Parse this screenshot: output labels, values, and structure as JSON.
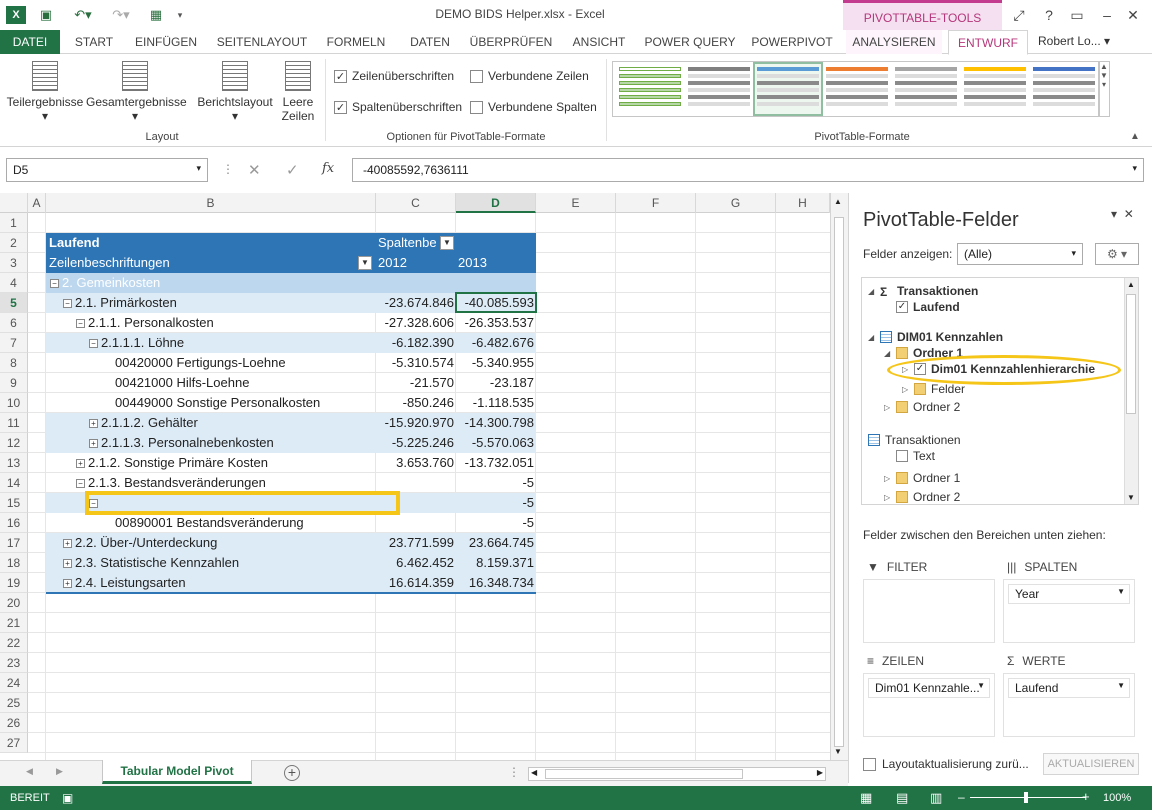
{
  "title": "DEMO BIDS Helper.xlsx - Excel",
  "contextual_tab_group": "PIVOTTABLE-TOOLS",
  "user": "Robert Lo...",
  "tabs": [
    "DATEI",
    "START",
    "EINFÜGEN",
    "SEITENLAYOUT",
    "FORMELN",
    "DATEN",
    "ÜBERPRÜFEN",
    "ANSICHT",
    "POWER QUERY",
    "POWERPIVOT",
    "ANALYSIEREN",
    "ENTWURF"
  ],
  "active_tab": "ENTWURF",
  "ribbon": {
    "layout_buttons": [
      "Teilergebnisse",
      "Gesamtergebnisse",
      "Berichtslayout",
      "Leere Zeilen"
    ],
    "layout_group": "Layout",
    "options": [
      {
        "label": "Zeilenüberschriften",
        "checked": true
      },
      {
        "label": "Verbundene Zeilen",
        "checked": false
      },
      {
        "label": "Spaltenüberschriften",
        "checked": true
      },
      {
        "label": "Verbundene Spalten",
        "checked": false
      }
    ],
    "options_group": "Optionen für PivotTable-Formate",
    "styles_group": "PivotTable-Formate",
    "style_colors": [
      "#70ad47",
      "#7f7f7f",
      "#5b9bd5",
      "#ed7d31",
      "#a5a5a5",
      "#ffc000",
      "#4472c4"
    ]
  },
  "formula_bar": {
    "name_box": "D5",
    "formula": "-40085592,7636111"
  },
  "columns": [
    "A",
    "B",
    "C",
    "D",
    "E",
    "F",
    "G",
    "H"
  ],
  "selected_column": "D",
  "selected_row": 5,
  "rows": [
    "1",
    "2",
    "3",
    "4",
    "5",
    "6",
    "7",
    "8",
    "9",
    "10",
    "11",
    "12",
    "13",
    "14",
    "15",
    "16",
    "17",
    "18",
    "19",
    "20",
    "21",
    "22",
    "23",
    "24",
    "25",
    "26",
    "27"
  ],
  "pivot": {
    "header_measure": "Laufend",
    "header_columns": "Spaltenbe",
    "header_rows": "Zeilenbeschriftungen",
    "year1": "2012",
    "year2": "2013",
    "lines": [
      {
        "row": 4,
        "label": "2. Gemeinkosten",
        "indent": 0,
        "toggle": "-",
        "c": "",
        "d": "",
        "style": "lvl1"
      },
      {
        "row": 5,
        "label": "2.1. Primärkosten",
        "indent": 1,
        "toggle": "-",
        "c": "-23.674.846",
        "d": "-40.085.593",
        "style": "band"
      },
      {
        "row": 6,
        "label": "2.1.1. Personalkosten",
        "indent": 2,
        "toggle": "-",
        "c": "-27.328.606",
        "d": "-26.353.537",
        "style": ""
      },
      {
        "row": 7,
        "label": "2.1.1.1. Löhne",
        "indent": 3,
        "toggle": "-",
        "c": "-6.182.390",
        "d": "-6.482.676",
        "style": "band"
      },
      {
        "row": 8,
        "label": "00420000 Fertigungs-Loehne",
        "indent": 5,
        "toggle": "",
        "c": "-5.310.574",
        "d": "-5.340.955",
        "style": ""
      },
      {
        "row": 9,
        "label": "00421000 Hilfs-Loehne",
        "indent": 5,
        "toggle": "",
        "c": "-21.570",
        "d": "-23.187",
        "style": ""
      },
      {
        "row": 10,
        "label": "00449000 Sonstige Personalkosten",
        "indent": 5,
        "toggle": "",
        "c": "-850.246",
        "d": "-1.118.535",
        "style": ""
      },
      {
        "row": 11,
        "label": "2.1.1.2. Gehälter",
        "indent": 3,
        "toggle": "+",
        "c": "-15.920.970",
        "d": "-14.300.798",
        "style": "band"
      },
      {
        "row": 12,
        "label": "2.1.1.3. Personalnebenkosten",
        "indent": 3,
        "toggle": "+",
        "c": "-5.225.246",
        "d": "-5.570.063",
        "style": "band"
      },
      {
        "row": 13,
        "label": "2.1.2. Sonstige Primäre Kosten",
        "indent": 2,
        "toggle": "+",
        "c": "3.653.760",
        "d": "-13.732.051",
        "style": ""
      },
      {
        "row": 14,
        "label": "2.1.3. Bestandsveränderungen",
        "indent": 2,
        "toggle": "-",
        "c": "",
        "d": "-5",
        "style": ""
      },
      {
        "row": 15,
        "label": "",
        "indent": 3,
        "toggle": "-",
        "c": "",
        "d": "-5",
        "style": "band"
      },
      {
        "row": 16,
        "label": "00890001 Bestandsveränderung",
        "indent": 5,
        "toggle": "",
        "c": "",
        "d": "-5",
        "style": ""
      },
      {
        "row": 17,
        "label": "2.2. Über-/Unterdeckung",
        "indent": 1,
        "toggle": "+",
        "c": "23.771.599",
        "d": "23.664.745",
        "style": "band"
      },
      {
        "row": 18,
        "label": "2.3. Statistische Kennzahlen",
        "indent": 1,
        "toggle": "+",
        "c": "6.462.452",
        "d": "8.159.371",
        "style": "band"
      },
      {
        "row": 19,
        "label": "2.4. Leistungsarten",
        "indent": 1,
        "toggle": "+",
        "c": "16.614.359",
        "d": "16.348.734",
        "style": "band"
      }
    ]
  },
  "panel": {
    "title": "PivotTable-Felder",
    "show_fields_label": "Felder anzeigen:",
    "show_fields_value": "(Alle)",
    "fields": [
      {
        "label": "Transaktionen",
        "type": "sigma",
        "bold": true
      },
      {
        "label": "Laufend",
        "type": "check",
        "checked": true,
        "bold": true
      },
      {
        "label": "DIM01 Kennzahlen",
        "type": "table",
        "bold": true
      },
      {
        "label": "Ordner 1",
        "type": "folder",
        "bold": true
      },
      {
        "label": "Dim01 Kennzahlenhierarchie",
        "type": "check",
        "checked": true,
        "bold": true
      },
      {
        "label": "Felder",
        "type": "folder",
        "bold": false
      },
      {
        "label": "Ordner 2",
        "type": "folder",
        "bold": false
      },
      {
        "label": "Transaktionen",
        "type": "table",
        "bold": false
      },
      {
        "label": "Text",
        "type": "check",
        "checked": false,
        "bold": false
      },
      {
        "label": "Ordner 1",
        "type": "folder",
        "bold": false
      },
      {
        "label": "Ordner 2",
        "type": "folder",
        "bold": false
      }
    ],
    "drag_label": "Felder zwischen den Bereichen unten ziehen:",
    "areas": {
      "filter": {
        "label": "FILTER",
        "item": ""
      },
      "columns": {
        "label": "SPALTEN",
        "item": "Year"
      },
      "rows": {
        "label": "ZEILEN",
        "item": "Dim01 Kennzahle..."
      },
      "values": {
        "label": "WERTE",
        "item": "Laufend"
      }
    },
    "defer_label": "Layoutaktualisierung zurü...",
    "update_button": "AKTUALISIEREN"
  },
  "sheet_tab": "Tabular Model Pivot",
  "status": "BEREIT",
  "zoom": "100%"
}
